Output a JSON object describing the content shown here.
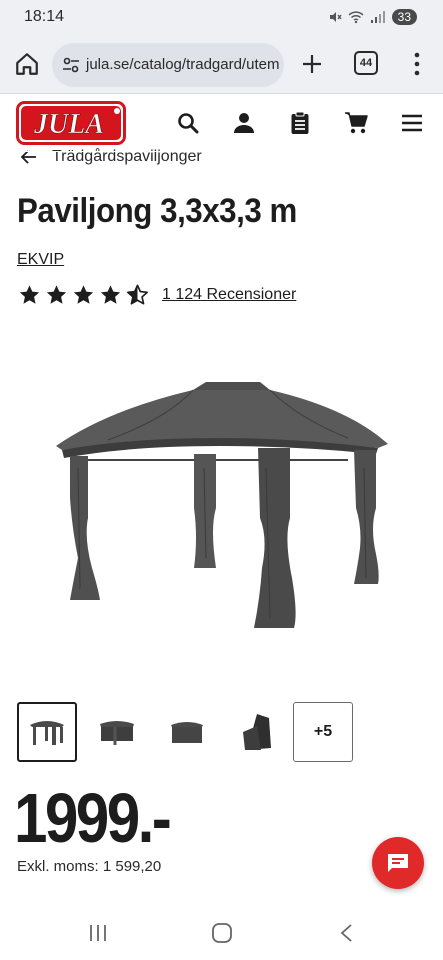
{
  "status": {
    "time": "18:14",
    "battery": "33"
  },
  "browser": {
    "url": "jula.se/catalog/tradgard/utem",
    "tab_count": "44"
  },
  "site": {
    "logo_text": "JULA",
    "brand_color": "#d4151d"
  },
  "breadcrumb": {
    "label": "Trädgårdspaviljonger"
  },
  "product": {
    "title": "Paviljong 3,3x3,3 m",
    "brand": "EKVIP",
    "rating": 4.5,
    "rating_max": 5,
    "reviews": "1 124 Recensioner",
    "more_images": "+5",
    "price": "1999.-",
    "excl_vat": "Exkl. moms: 1 599,20"
  },
  "icons": {
    "header": [
      "search-icon",
      "user-icon",
      "clipboard-icon",
      "cart-icon",
      "hamburger-menu-icon"
    ],
    "chat": "chat-icon"
  },
  "colors": {
    "chat_button": "#e02a2a",
    "text": "#1d1d1d",
    "browser_chrome": "#eef0f4"
  }
}
